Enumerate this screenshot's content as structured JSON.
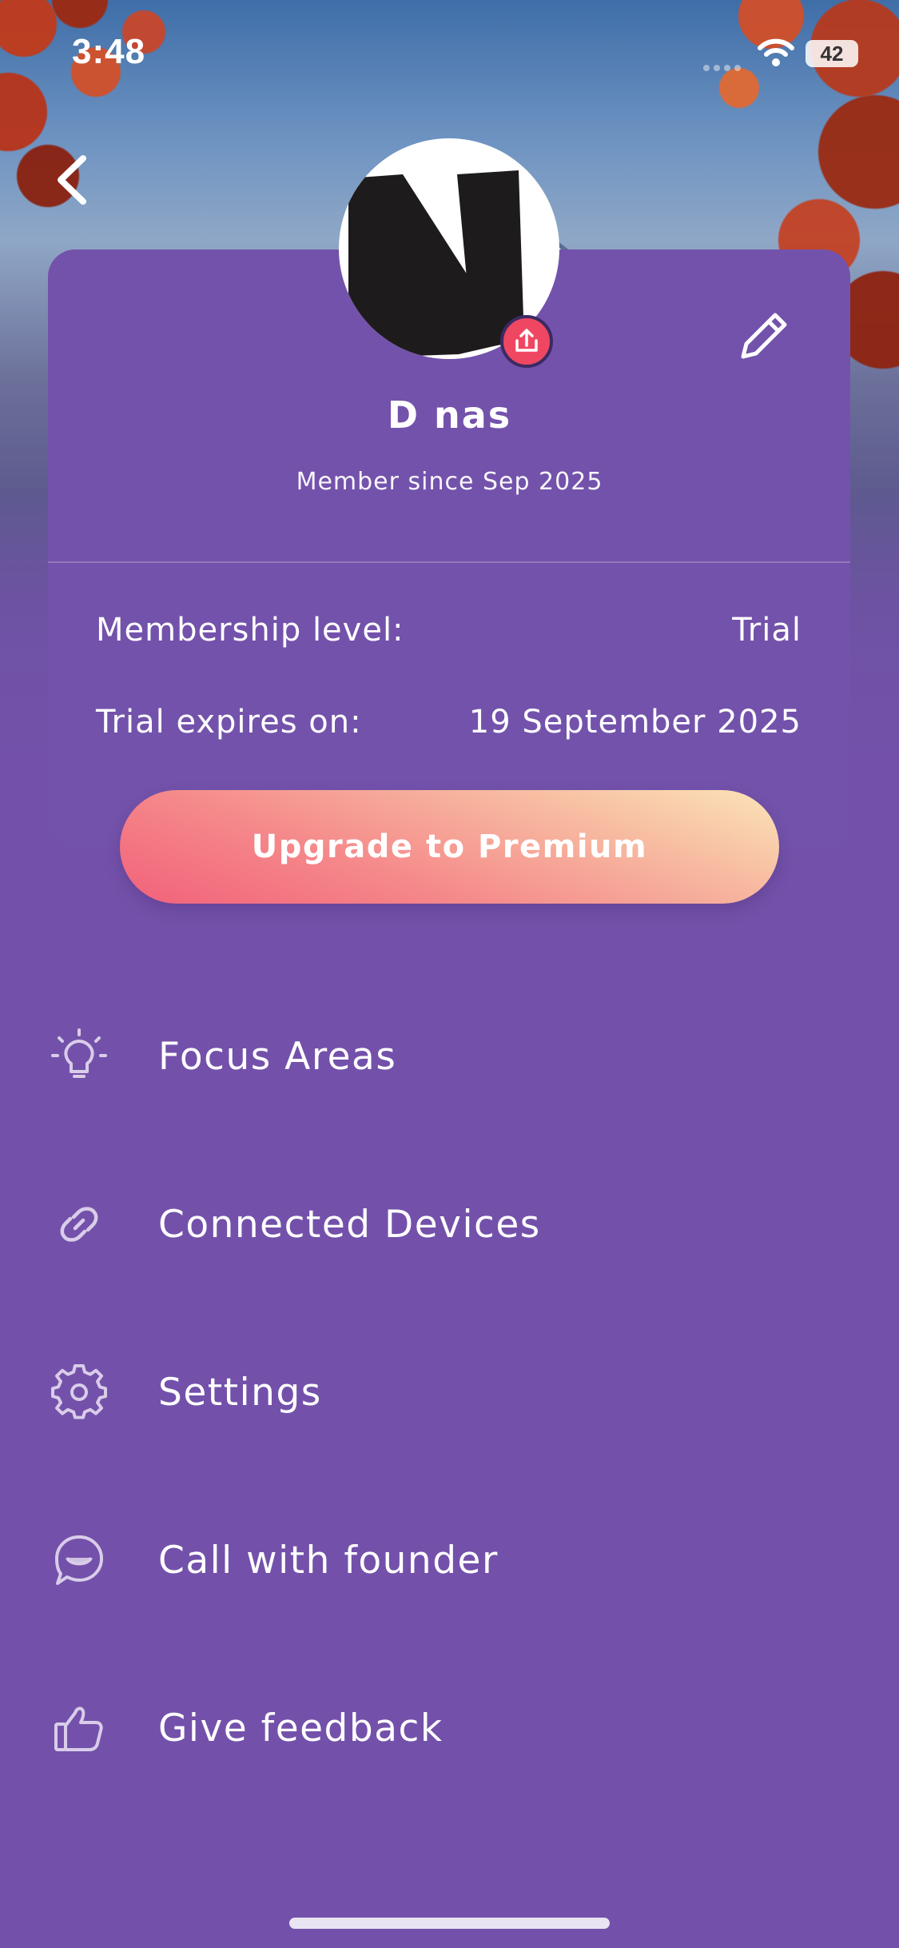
{
  "status_bar": {
    "time": "3:48",
    "battery": "42"
  },
  "profile": {
    "name": "D nas",
    "member_since": "Member since Sep 2025",
    "avatar_letter": "N"
  },
  "membership": {
    "level_label": "Membership level:",
    "level_value": "Trial",
    "expires_label": "Trial expires on:",
    "expires_value": "19 September 2025"
  },
  "upgrade_label": "Upgrade to Premium",
  "menu": [
    {
      "label": "Focus Areas",
      "icon": "lightbulb-icon"
    },
    {
      "label": "Connected Devices",
      "icon": "link-icon"
    },
    {
      "label": "Settings",
      "icon": "gear-icon"
    },
    {
      "label": "Call with founder",
      "icon": "chat-bubble-icon"
    },
    {
      "label": "Give feedback",
      "icon": "thumbs-up-icon"
    }
  ],
  "colors": {
    "background": "#7351aa",
    "upload_badge": "#ef4762",
    "upgrade_gradient_start": "#f2617a",
    "upgrade_gradient_end": "#fbe4b8"
  }
}
